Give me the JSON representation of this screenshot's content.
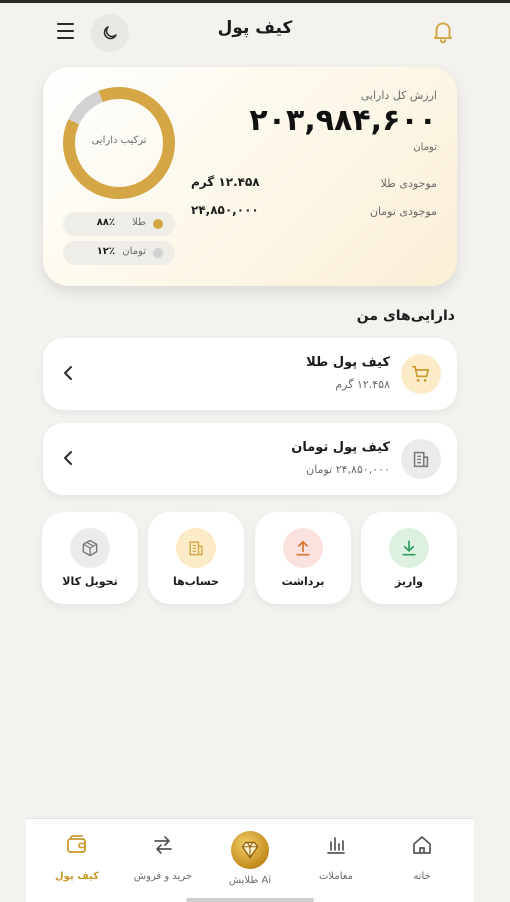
{
  "header": {
    "title": "کیف پول"
  },
  "summary": {
    "total_label": "ارزش کل دارایی",
    "total_value": "۲۰۳,۹۸۴,۶۰۰",
    "total_unit": "تومان",
    "rows": [
      {
        "label": "موجودی طلا",
        "value": "۱۲.۴۵۸ گرم"
      },
      {
        "label": "موجودی تومان",
        "value": "۲۴,۸۵۰,۰۰۰"
      }
    ],
    "chart_caption": "ترکیب دارایی",
    "legend": [
      {
        "name": "طلا",
        "pct_label": "۸۸٪",
        "color": "#d4a645"
      },
      {
        "name": "تومان",
        "pct_label": "۱۲٪",
        "color": "#d2d2d2"
      }
    ]
  },
  "chart_data": {
    "type": "pie",
    "categories": [
      "طلا",
      "تومان"
    ],
    "values": [
      88,
      12
    ],
    "title": "ترکیب دارایی"
  },
  "section_title": "دارایی‌های من",
  "wallets": [
    {
      "title": "کیف پول طلا",
      "subtitle": "۱۲.۴۵۸ گرم",
      "icon": "cart-icon",
      "accent": "#c9992e"
    },
    {
      "title": "کیف پول تومان",
      "subtitle": "۲۴,۸۵۰,۰۰۰ تومان",
      "icon": "building-icon",
      "accent": "#7a7a7a"
    }
  ],
  "actions": [
    {
      "label": "واریز",
      "icon": "download-icon",
      "color": "#2e9e5b"
    },
    {
      "label": "برداشت",
      "icon": "upload-icon",
      "color": "#d9752a"
    },
    {
      "label": "حساب‌ها",
      "icon": "building-icon",
      "color": "#d4a645"
    },
    {
      "label": "تحویل کالا",
      "icon": "box-icon",
      "color": "#7a7a7a"
    }
  ],
  "nav": [
    {
      "label": "خانه",
      "icon": "home-icon"
    },
    {
      "label": "معاملات",
      "icon": "bar-chart-icon"
    },
    {
      "label": "طلایش Ai",
      "icon": "diamond-icon"
    },
    {
      "label": "خرید و فروش",
      "icon": "swap-icon"
    },
    {
      "label": "کیف پول",
      "icon": "wallet-icon",
      "active": true
    }
  ]
}
